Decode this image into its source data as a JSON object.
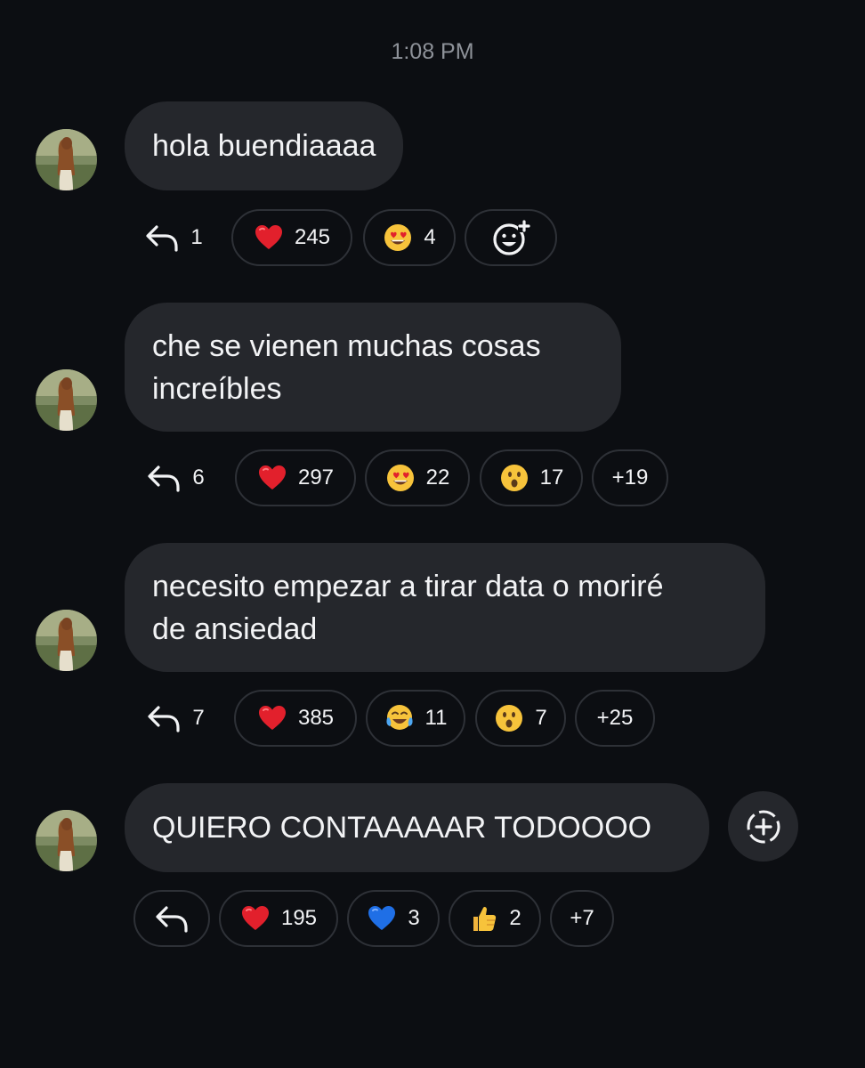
{
  "timestamp": "1:08 PM",
  "messages": [
    {
      "text": "hola buendiaaaa",
      "reply_count": "1",
      "reactions": [
        {
          "icon": "red-heart",
          "count": "245"
        },
        {
          "icon": "heart-eyes",
          "count": "4"
        }
      ],
      "add_reaction_icon": "add-reaction-icon"
    },
    {
      "text": "che se vienen muchas cosas\nincreíbles",
      "reply_count": "6",
      "reactions": [
        {
          "icon": "red-heart",
          "count": "297"
        },
        {
          "icon": "heart-eyes",
          "count": "22"
        },
        {
          "icon": "surprised-face",
          "count": "17"
        }
      ],
      "more": "+19"
    },
    {
      "text": "necesito empezar a tirar data o moriré\nde ansiedad",
      "reply_count": "7",
      "reactions": [
        {
          "icon": "red-heart",
          "count": "385"
        },
        {
          "icon": "tears-of-joy",
          "count": "11"
        },
        {
          "icon": "surprised-face",
          "count": "7"
        }
      ],
      "more": "+25"
    },
    {
      "text": "QUIERO CONTAAAAAR TODOOOO",
      "reply_count": "",
      "reactions": [
        {
          "icon": "red-heart",
          "count": "195"
        },
        {
          "icon": "blue-heart",
          "count": "3"
        },
        {
          "icon": "thumbs-up",
          "count": "2"
        }
      ],
      "more": "+7"
    }
  ],
  "colors": {
    "background": "#0c0e12",
    "bubble": "#25272c",
    "pill_border": "#2e3137",
    "timestamp": "#8e9299"
  }
}
